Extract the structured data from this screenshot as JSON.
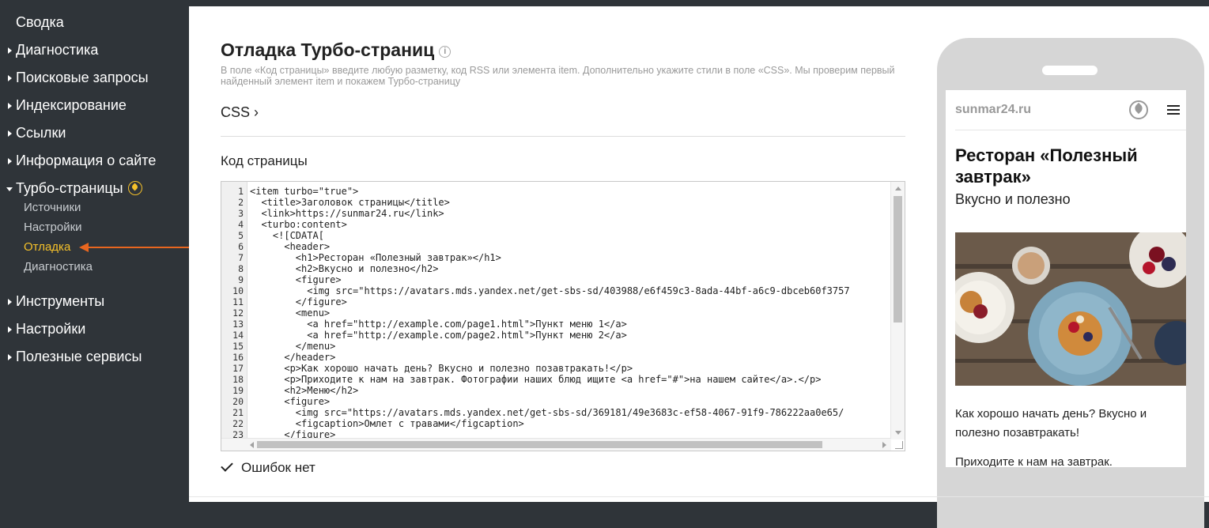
{
  "sidebar": {
    "items": [
      {
        "label": "Сводка"
      },
      {
        "label": "Диагностика"
      },
      {
        "label": "Поисковые запросы"
      },
      {
        "label": "Индексирование"
      },
      {
        "label": "Ссылки"
      },
      {
        "label": "Информация о сайте"
      },
      {
        "label": "Турбо-страницы"
      },
      {
        "label": "Инструменты"
      },
      {
        "label": "Настройки"
      },
      {
        "label": "Полезные сервисы"
      }
    ],
    "turbo_sub": [
      {
        "label": "Источники"
      },
      {
        "label": "Настройки"
      },
      {
        "label": "Отладка"
      },
      {
        "label": "Диагностика"
      }
    ]
  },
  "main": {
    "title": "Отладка Турбо-страниц",
    "info_icon": "i",
    "hint": "В поле «Код страницы» введите любую разметку, код RSS или элемента item. Дополнительно укажите стили в поле «CSS». Мы проверим первый найденный элемент item и покажем Турбо-страницу",
    "css_label": "CSS ›",
    "code_label": "Код страницы",
    "status": "Ошибок нет"
  },
  "editor": {
    "line_numbers": [
      "1",
      "2",
      "3",
      "4",
      "5",
      "6",
      "7",
      "8",
      "9",
      "10",
      "11",
      "12",
      "13",
      "14",
      "15",
      "16",
      "17",
      "18",
      "19",
      "20",
      "21",
      "22",
      "23"
    ],
    "lines": [
      "<item turbo=\"true\">",
      "  <title>Заголовок страницы</title>",
      "  <link>https://sunmar24.ru</link>",
      "  <turbo:content>",
      "    <![CDATA[",
      "      <header>",
      "        <h1>Ресторан «Полезный завтрак»</h1>",
      "        <h2>Вкусно и полезно</h2>",
      "        <figure>",
      "          <img src=\"https://avatars.mds.yandex.net/get-sbs-sd/403988/e6f459c3-8ada-44bf-a6c9-dbceb60f3757",
      "        </figure>",
      "        <menu>",
      "          <a href=\"http://example.com/page1.html\">Пункт меню 1</a>",
      "          <a href=\"http://example.com/page2.html\">Пункт меню 2</a>",
      "        </menu>",
      "      </header>",
      "      <p>Как хорошо начать день? Вкусно и полезно позавтракать!</p>",
      "      <p>Приходите к нам на завтрак. Фотографии наших блюд ищите <a href=\"#\">на нашем сайте</a>.</p>",
      "      <h2>Меню</h2>",
      "      <figure>",
      "        <img src=\"https://avatars.mds.yandex.net/get-sbs-sd/369181/49e3683c-ef58-4067-91f9-786222aa0e65/",
      "        <figcaption>Омлет с травами</figcaption>",
      "      </figure>"
    ]
  },
  "preview": {
    "site": "sunmar24.ru",
    "h1": "Ресторан «Полезный завтрак»",
    "h2": "Вкусно и полезно",
    "p1": "Как хорошо начать день? Вкусно и полезно позавтракать!",
    "p2": "Приходите к нам на завтрак."
  },
  "colors": {
    "sidebar_bg": "#2f3439",
    "active": "#f5c12a",
    "arrow": "#e8661f"
  }
}
